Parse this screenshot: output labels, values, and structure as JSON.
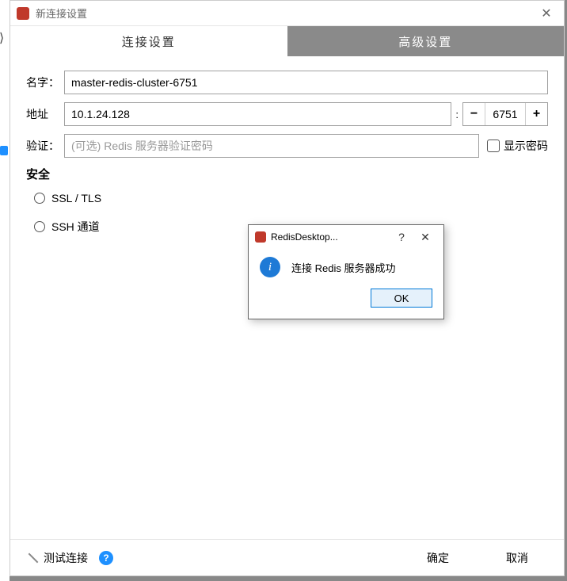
{
  "window": {
    "title": "新连接设置"
  },
  "tabs": {
    "connection": "连接设置",
    "advanced": "高级设置"
  },
  "labels": {
    "name": "名字：",
    "address": "地址",
    "auth": "验证：",
    "security": "安全"
  },
  "fields": {
    "name_value": "master-redis-cluster-6751",
    "address_value": "10.1.24.128",
    "port_value": "6751",
    "auth_placeholder": "(可选) Redis 服务器验证密码",
    "show_password": "显示密码"
  },
  "security": {
    "ssl": "SSL / TLS",
    "ssh": "SSH 通道"
  },
  "footer": {
    "test": "测试连接",
    "ok": "确定",
    "cancel": "取消"
  },
  "modal": {
    "title": "RedisDesktop...",
    "message": "连接 Redis 服务器成功",
    "ok": "OK"
  }
}
